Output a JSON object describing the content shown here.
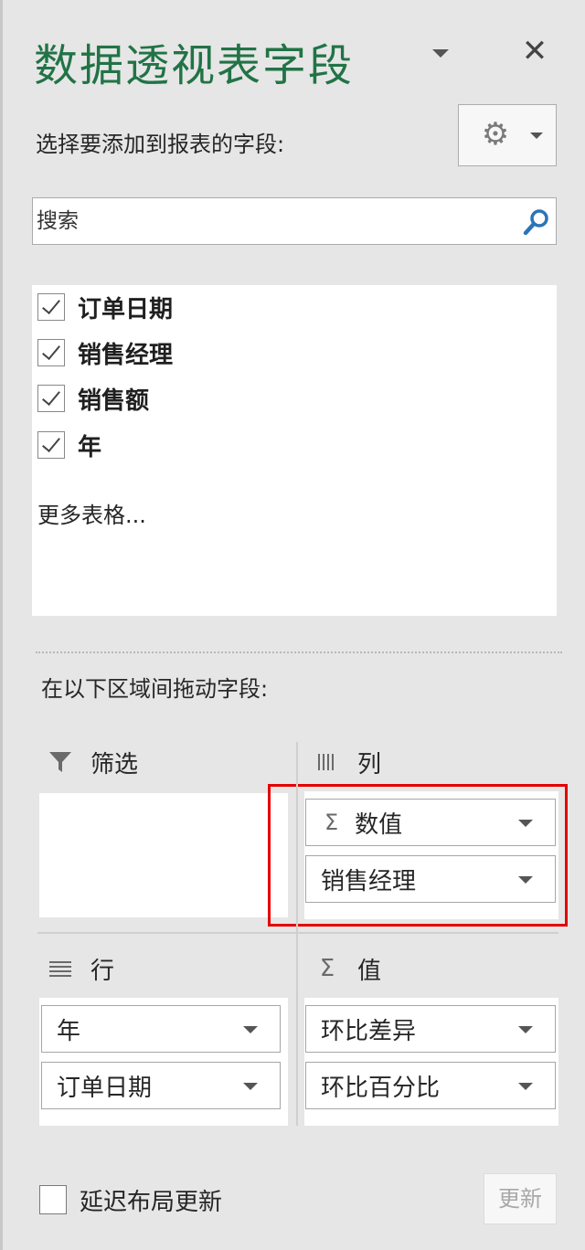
{
  "pane": {
    "title": "数据透视表字段",
    "close_glyph": "✕",
    "subtitle": "选择要添加到报表的字段:",
    "settings_icon": "gear-icon",
    "search_placeholder": "搜索",
    "search_icon": "magnifier-icon"
  },
  "fields": [
    {
      "label": "订单日期",
      "checked": true
    },
    {
      "label": "销售经理",
      "checked": true
    },
    {
      "label": "销售额",
      "checked": true
    },
    {
      "label": "年",
      "checked": true
    }
  ],
  "more_tables_label": "更多表格...",
  "areas": {
    "hint": "在以下区域间拖动字段:",
    "filters": {
      "label": "筛选",
      "icon": "filter-icon",
      "items": []
    },
    "columns": {
      "label": "列",
      "icon": "columns-icon",
      "items": [
        {
          "label": "数值",
          "sigma": true
        },
        {
          "label": "销售经理",
          "sigma": false
        }
      ]
    },
    "rows": {
      "label": "行",
      "icon": "rows-icon",
      "items": [
        {
          "label": "年"
        },
        {
          "label": "订单日期"
        }
      ]
    },
    "values": {
      "label": "值",
      "icon": "sigma-icon",
      "items": [
        {
          "label": "环比差异"
        },
        {
          "label": "环比百分比"
        }
      ]
    }
  },
  "footer": {
    "defer_label": "延迟布局更新",
    "defer_checked": false,
    "update_label": "更新"
  },
  "colors": {
    "title_green": "#217346",
    "highlight_red": "#e50000"
  }
}
